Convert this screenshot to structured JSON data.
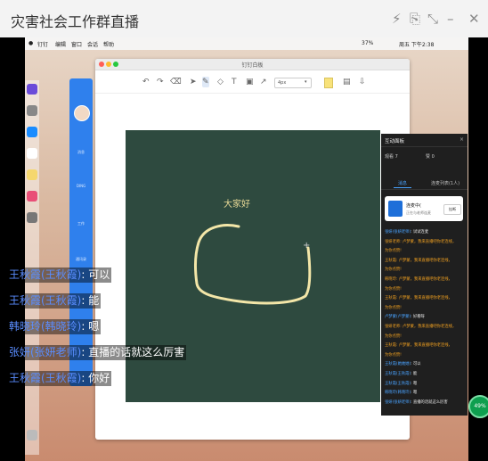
{
  "window": {
    "title": "灾害社会工作群直播",
    "icons": [
      "lightning-icon",
      "share-icon",
      "collapse-icon",
      "minimize-icon",
      "close-icon"
    ]
  },
  "mac": {
    "menubar": [
      "钉钉",
      "编辑",
      "窗口",
      "会话",
      "帮助"
    ],
    "time": "周五 下午2:38",
    "battery": "37%"
  },
  "app": {
    "title": "钉钉白板",
    "toolbar_select": "4px",
    "sidebar_items": [
      "消息",
      "DING",
      "工作",
      "通讯录"
    ]
  },
  "whiteboard": {
    "greeting": "大家好"
  },
  "chat_panel": {
    "title": "互动面板",
    "viewers": "观看 7",
    "likes": "赞 0",
    "tabs": [
      "消息",
      "连麦列表(1人)"
    ],
    "notice": {
      "title": "连麦中(",
      "subtitle": "正在与老师连麦",
      "button": "挂断"
    },
    "messages": [
      {
        "name": "张妍(张妍老师)",
        "text": ": 试试连麦",
        "color": "blue"
      },
      {
        "name": "张妍老师",
        "text": ": 卢梦蒙，我来直播吧你老连线，",
        "color": "orange"
      },
      {
        "name": "",
        "text": "为你点赞!",
        "color": "orange"
      },
      {
        "name": "王秋霞",
        "text": ": 卢梦蒙，我来直播吧你老连线，",
        "color": "orange"
      },
      {
        "name": "",
        "text": "为你点赞!",
        "color": "orange"
      },
      {
        "name": "韩晓玲",
        "text": ": 卢梦蒙，我来直播吧你老连线，",
        "color": "orange"
      },
      {
        "name": "",
        "text": "为你点赞!",
        "color": "orange"
      },
      {
        "name": "王秋霞",
        "text": ": 卢梦蒙，我来直播吧你老连线，",
        "color": "orange"
      },
      {
        "name": "",
        "text": "为你点赞!",
        "color": "orange"
      },
      {
        "name": "卢梦蒙(卢梦蒙)",
        "text": ": 好看呀",
        "color": "blue"
      },
      {
        "name": "张妍老师",
        "text": ": 卢梦蒙，我来直播吧你老连线，",
        "color": "orange"
      },
      {
        "name": "",
        "text": "为你点赞!",
        "color": "orange"
      },
      {
        "name": "王秋霞",
        "text": ": 卢梦蒙，我来直播吧你老连线，",
        "color": "orange"
      },
      {
        "name": "",
        "text": "为你点赞!",
        "color": "orange"
      },
      {
        "name": "王秋霞(她她她)",
        "text": ": 可以",
        "color": "blue"
      },
      {
        "name": "王秋霞(王秋霞)",
        "text": ": 能",
        "color": "blue"
      },
      {
        "name": "王秋霞(王秋霞)",
        "text": ": 嗯",
        "color": "blue"
      },
      {
        "name": "韩晓玲(韩晓玲)",
        "text": ": 嗯",
        "color": "blue"
      },
      {
        "name": "张妍(张妍老师)",
        "text": ": 直播的话就这么厉害",
        "color": "blue"
      }
    ]
  },
  "overlay_chat": [
    {
      "name": "王秋霞(王秋霞)",
      "text": ": 可以"
    },
    {
      "name": "王秋霞(王秋霞)",
      "text": ": 能"
    },
    {
      "name": "韩晓玲(韩晓玲)",
      "text": ": 嗯"
    },
    {
      "name": "张妍(张妍老师)",
      "text": ": 直播的话就这么厉害"
    },
    {
      "name": "王秋霞(王秋霞)",
      "text": ": 你好"
    }
  ],
  "status_badge": "49%",
  "colors": {
    "board": "#2e4a3f",
    "stroke": "#f3e6a8",
    "accent": "#4aa3ff",
    "name_blue": "#5a8dff"
  }
}
